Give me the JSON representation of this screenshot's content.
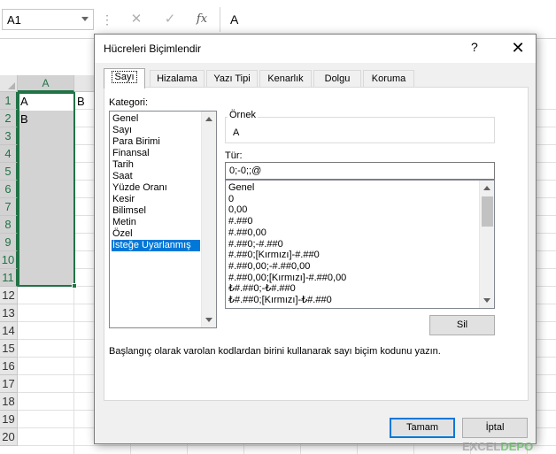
{
  "formula_bar": {
    "name_box": "A1",
    "cancel_icon": "✕",
    "enter_icon": "✓",
    "fx_label": "fx",
    "content": "A"
  },
  "grid": {
    "columns": [
      "A"
    ],
    "rows": [
      "1",
      "2",
      "3",
      "4",
      "5",
      "6",
      "7",
      "8",
      "9",
      "10",
      "11",
      "12",
      "13",
      "14",
      "15",
      "16",
      "17",
      "18",
      "19",
      "20"
    ],
    "cells": {
      "A1": "A",
      "B1": "B",
      "A2": "B"
    }
  },
  "dialog": {
    "title": "Hücreleri Biçimlendir",
    "help": "?",
    "close": "✕",
    "tabs": [
      "Sayı",
      "Hizalama",
      "Yazı Tipi",
      "Kenarlık",
      "Dolgu",
      "Koruma"
    ],
    "category_label": "Kategori:",
    "categories": [
      "Genel",
      "Sayı",
      "Para Birimi",
      "Finansal",
      "Tarih",
      "Saat",
      "Yüzde Oranı",
      "Kesir",
      "Bilimsel",
      "Metin",
      "Özel",
      "İsteğe Uyarlanmış"
    ],
    "selected_category": "İsteğe Uyarlanmış",
    "sample_label": "Örnek",
    "sample_value": "A",
    "type_label": "Tür:",
    "type_value": "0;-0;;@",
    "formats": [
      "Genel",
      "0",
      "0,00",
      "#.##0",
      "#.##0,00",
      "#.##0;-#.##0",
      "#.##0;[Kırmızı]-#.##0",
      "#.##0,00;-#.##0,00",
      "#.##0,00;[Kırmızı]-#.##0,00",
      "₺#.##0;-₺#.##0",
      "₺#.##0;[Kırmızı]-₺#.##0"
    ],
    "delete_button": "Sil",
    "description": "Başlangıç olarak varolan kodlardan birini kullanarak sayı biçim kodunu yazın.",
    "ok_button": "Tamam",
    "cancel_button": "İptal"
  },
  "watermark": {
    "part1": "EXCEL",
    "part2": "DEPO"
  },
  "colors": {
    "accent": "#217346",
    "selection": "#0078d7"
  }
}
